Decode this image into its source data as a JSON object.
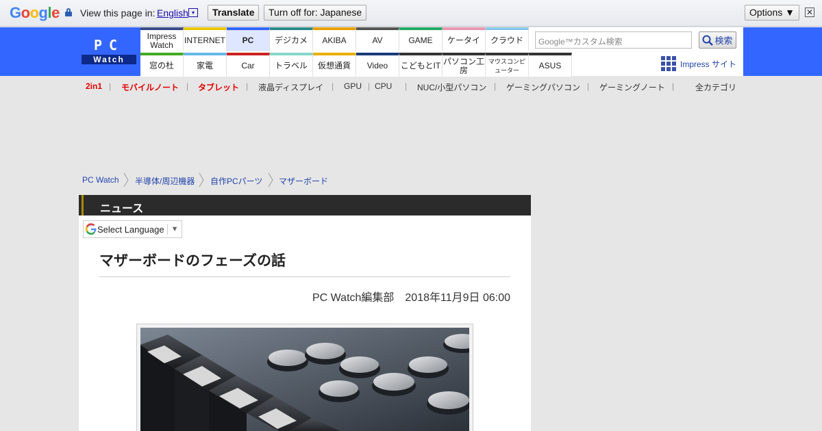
{
  "translate_bar": {
    "logo": [
      "G",
      "o",
      "o",
      "g",
      "l",
      "e"
    ],
    "view_text": "View this page in:",
    "language": "English",
    "language_arrow": "▾",
    "translate_label": "Translate",
    "turnoff_label": "Turn off for: Japanese",
    "options_label": "Options ▼",
    "close_label": "✕"
  },
  "header": {
    "logo_top": "PC",
    "logo_bottom": "Watch",
    "nav_row1": [
      {
        "label": "Impress Watch",
        "color": "#3a4a8a"
      },
      {
        "label": "INTERNET",
        "color": "#e8c800"
      },
      {
        "label": "PC",
        "color": "#3366ff",
        "active": true
      },
      {
        "label": "デジカメ",
        "color": "#2a8a8a"
      },
      {
        "label": "AKIBA",
        "color": "#e8a000"
      },
      {
        "label": "AV",
        "color": "#555555"
      },
      {
        "label": "GAME",
        "color": "#22aa66"
      },
      {
        "label": "ケータイ",
        "color": "#e898b0"
      },
      {
        "label": "クラウド",
        "color": "#88c8e8"
      }
    ],
    "nav_row2": [
      {
        "label": "窓の杜",
        "color": "#44aa22"
      },
      {
        "label": "家電",
        "color": "#66b8e8"
      },
      {
        "label": "Car",
        "color": "#cc2222"
      },
      {
        "label": "トラベル",
        "color": "#88d8c8"
      },
      {
        "label": "仮想通貨",
        "color": "#e8b000"
      },
      {
        "label": "Video",
        "color": "#1a3a7a"
      },
      {
        "label": "こどもとIT",
        "color": "#333333"
      },
      {
        "label": "パソコン工房",
        "color": "#333333"
      },
      {
        "label": "マウスコンピューター",
        "color": "#333333",
        "small": true
      },
      {
        "label": "ASUS",
        "color": "#333333"
      }
    ],
    "search_placeholder": "Google™カスタム検索",
    "search_button": "検索",
    "impress_sites": "Impress サイト"
  },
  "tags": [
    {
      "label": "2in1",
      "red": true
    },
    {
      "label": "モバイルノート",
      "red": true
    },
    {
      "label": "タブレット",
      "red": true
    },
    {
      "label": "液晶ディスプレイ"
    },
    {
      "label": "GPU"
    },
    {
      "label": "CPU"
    },
    {
      "label": "NUC/小型パソコン"
    },
    {
      "label": "ゲーミングパソコン"
    },
    {
      "label": "ゲーミングノート"
    },
    {
      "label": "全カテゴリ"
    }
  ],
  "breadcrumb": [
    "PC Watch",
    "半導体/周辺機器",
    "自作PCパーツ",
    "マザーボード"
  ],
  "article": {
    "section": "ニュース",
    "language_select": "Select Language",
    "title": "マザーボードのフェーズの話",
    "byline": "PC Watch編集部　2018年11月9日 06:00"
  }
}
